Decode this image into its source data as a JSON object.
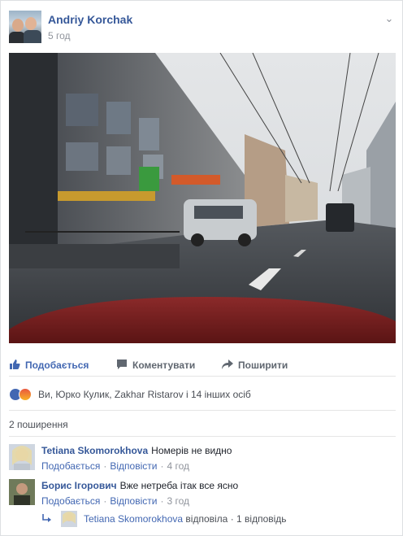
{
  "post": {
    "author": "Andriy Korchak",
    "time": "5 год"
  },
  "actions": {
    "like": "Подобається",
    "comment": "Коментувати",
    "share": "Поширити"
  },
  "reactions": {
    "icons": [
      "like-reaction",
      "angry-reaction"
    ],
    "text": "Ви, Юрко Кулик, Zakhar Ristarov і 14 інших осіб"
  },
  "shares": "2 поширення",
  "comments": [
    {
      "name": "Tetiana Skomorokhova",
      "text": "Номерів не видно",
      "like": "Подобається",
      "reply": "Відповісти",
      "time": "4 год"
    },
    {
      "name": "Борис Ігорович",
      "text": "Вже нетреба ітак все ясно",
      "like": "Подобається",
      "reply": "Відповісти",
      "time": "3 год"
    }
  ],
  "reply_summary": {
    "name": "Tetiana Skomorokhova",
    "verb": "відповіла",
    "count": "1 відповідь"
  },
  "colors": {
    "link": "#365899",
    "accent": "#4267b2",
    "muted": "#90949c"
  }
}
